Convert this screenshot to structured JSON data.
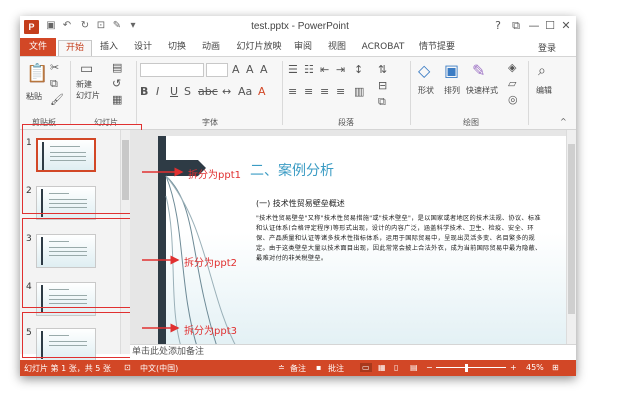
{
  "window": {
    "title": "test.pptx - PowerPoint",
    "app_icon": "P",
    "controls": [
      "?",
      "⧉",
      "—",
      "☐",
      "✕"
    ]
  },
  "ribbon": {
    "tabs": [
      "文件",
      "开始",
      "插入",
      "设计",
      "切换",
      "动画",
      "幻灯片放映",
      "审阅",
      "视图",
      "ACROBAT",
      "情节提要"
    ],
    "active_tab": "开始",
    "login": "登录",
    "groups": {
      "clipboard": {
        "label": "剪贴板",
        "paste": "粘贴"
      },
      "slides": {
        "label": "幻灯片",
        "new_slide": "新建\n幻灯片"
      },
      "font": {
        "label": "字体"
      },
      "paragraph": {
        "label": "段落"
      },
      "drawing": {
        "label": "绘图",
        "shapes": "形状",
        "arrange": "排列",
        "quick_styles": "快速样式"
      },
      "editing": {
        "label": "编辑"
      }
    }
  },
  "slides": [
    {
      "number": "1",
      "selected": true
    },
    {
      "number": "2",
      "selected": false
    },
    {
      "number": "3",
      "selected": false
    },
    {
      "number": "4",
      "selected": false
    },
    {
      "number": "5",
      "selected": false
    }
  ],
  "annotations": [
    "拆分为ppt1",
    "拆分为ppt2",
    "拆分为ppt3"
  ],
  "slide": {
    "title": "二、案例分析",
    "subtitle": "(一) 技术性贸易壁垒概述",
    "body": "\"技术性贸易壁垒\"又称\"技术性贸易措施\"或\"技术壁垒\"，是以国家或者地区的技术法规、协议、标准和认证体系(合格评定程序)等形式出现，设计的内容广泛，涵盖科学技术、卫生、检疫、安全、环保、产品质量和认证等诸多技术性指标体系，运用于国际贸易中，呈现出灵活多变、名目繁多的规定。由于这类壁垒大量以技术面目出现，因此常常会披上合法外衣，成为当前国际贸易中最为隐蔽、最难对付的非关税壁垒。"
  },
  "notes_placeholder": "单击此处添加备注",
  "status": {
    "slide_info": "幻灯片 第 1 张，共 5 张",
    "language": "中文(中国)",
    "notes": "备注",
    "comments": "批注",
    "zoom": "45%"
  },
  "colors": {
    "accent": "#d24726",
    "title_blue": "#3b9cc4",
    "annotation_red": "#e03030"
  }
}
